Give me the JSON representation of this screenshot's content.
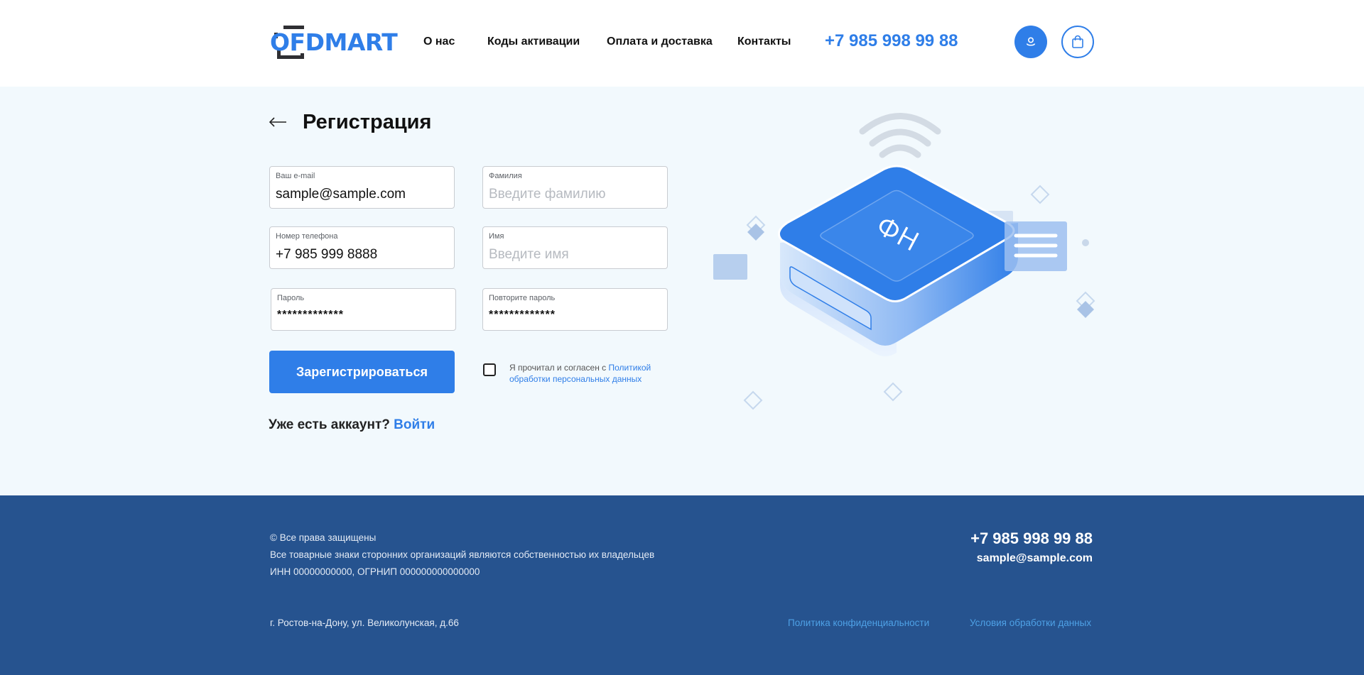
{
  "header": {
    "logo_text": "OFDMART",
    "nav": [
      "О нас",
      "Коды активации",
      "Оплата и доставка",
      "Контакты"
    ],
    "phone": "+7 985 998 99 88",
    "icons": {
      "user": "user-icon",
      "cart": "shopping-bag-icon"
    }
  },
  "main": {
    "title": "Регистрация",
    "back_icon": "arrow-left-icon",
    "fields": {
      "email": {
        "label": "Ваш e-mail",
        "value": "sample@sample.com"
      },
      "lastname": {
        "label": "Фамилия",
        "placeholder": "Введите фамилию"
      },
      "phone": {
        "label": "Номер телефона",
        "value": "+7 985 999 8888"
      },
      "firstname": {
        "label": "Имя",
        "placeholder": "Введите имя"
      },
      "password": {
        "label": "Пароль",
        "value": "*************"
      },
      "password_repeat": {
        "label": "Повторите пароль",
        "value": "*************"
      }
    },
    "register_button": "Зарегистрироваться",
    "consent": {
      "prefix": "Я прочитал и согласен с ",
      "link": "Политикой обработки персональных данных",
      "checked": false
    },
    "account": {
      "question": "Уже есть аккаунт?",
      "login_link": "Войти"
    },
    "illustration": {
      "device_label": "ФН"
    }
  },
  "footer": {
    "rights": "© Все права защищены",
    "trademarks": "Все товарные знаки сторонних организаций являются собственностью их владельцев",
    "requisites": "ИНН 00000000000, ОГРНИП 000000000000000",
    "address": "г. Ростов-на-Дону, ул. Великолунская, д.66",
    "phone": "+7 985 998 99 88",
    "email": "sample@sample.com",
    "privacy_link": "Политика конфиденциальности",
    "data_terms_link": "Условия обработки данных"
  },
  "colors": {
    "accent": "#2f7ee8",
    "footer_bg": "#26538f",
    "main_bg": "#f2f9fd"
  }
}
